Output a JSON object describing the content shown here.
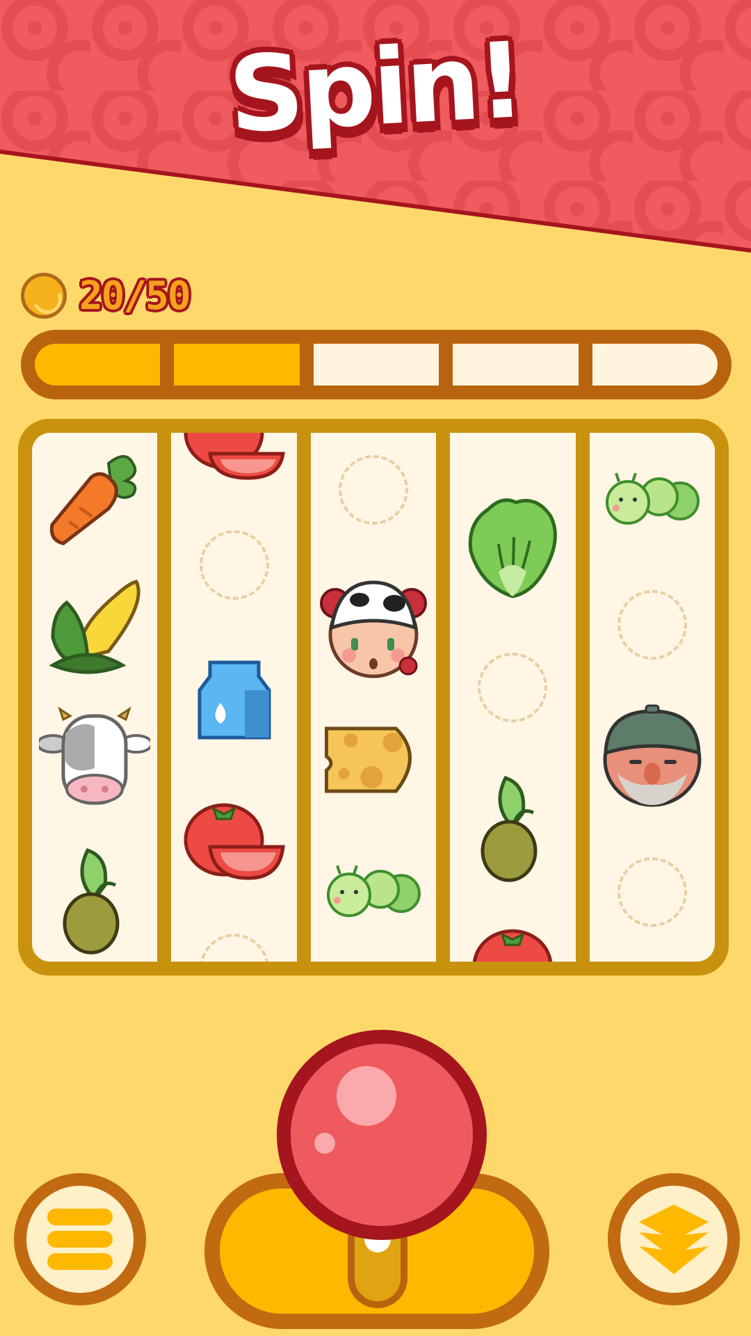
{
  "header": {
    "title": "Spin!"
  },
  "coins": {
    "text": "20/50",
    "current": 20,
    "goal": 50
  },
  "progress": {
    "segments": 5,
    "filled": 2
  },
  "reels": [
    {
      "symbols": [
        "carrot",
        "corn",
        "cow",
        "sprout"
      ]
    },
    {
      "symbols": [
        "tomato",
        "empty",
        "milk",
        "tomato",
        "empty"
      ]
    },
    {
      "symbols": [
        "empty",
        "farmer-girl",
        "cheese",
        "caterpillar"
      ]
    },
    {
      "symbols": [
        "cabbage",
        "empty",
        "sprout",
        "tomato"
      ]
    },
    {
      "symbols": [
        "caterpillar",
        "empty",
        "old-farmer",
        "empty"
      ]
    }
  ],
  "controls": {
    "menu_icon": "menu-icon",
    "spin_lever": "spin-lever",
    "layers_icon": "layers-icon"
  },
  "colors": {
    "background": "#FFD86B",
    "banner": "#EF5B5E",
    "title_outline": "#A5151D",
    "progress_fill": "#FFB800"
  }
}
